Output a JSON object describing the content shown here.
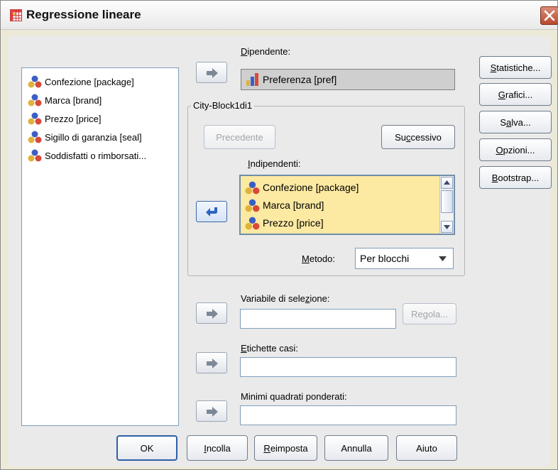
{
  "window": {
    "title": "Regressione lineare",
    "title_icon": "table-grid-icon",
    "close_icon": "close-icon"
  },
  "variables": [
    "Confezione [package]",
    "Marca [brand]",
    "Prezzo [price]",
    "Sigillo di garanzia [seal]",
    "Soddisfatti o rimborsati..."
  ],
  "dependent": {
    "label_underlined": "D",
    "label_rest": "ipendente:",
    "value": "Preferenza [pref]"
  },
  "block": {
    "title": "City-Block1di1",
    "prev_label": "Precedente",
    "next_label_pre": "Su",
    "next_label_u": "c",
    "next_label_post": "cessivo"
  },
  "independents": {
    "label_underlined": "I",
    "label_rest": "ndipendenti:",
    "items": [
      "Confezione [package]",
      "Marca [brand]",
      "Prezzo [price]"
    ]
  },
  "method": {
    "label_underlined": "M",
    "label_rest": "etodo:",
    "value": "Per blocchi"
  },
  "selection": {
    "label_pre": "Variabile di sele",
    "label_u": "z",
    "label_post": "ione:",
    "value": "",
    "rule_label_pre": "Re",
    "rule_label_u": "g",
    "rule_label_post": "ola..."
  },
  "case_labels": {
    "label_underlined": "E",
    "label_rest": "tichette casi:",
    "value": ""
  },
  "wls": {
    "label": "Minimi quadrati ponderati:",
    "value": ""
  },
  "side_buttons": [
    {
      "pre": "",
      "u": "S",
      "post": "tatistiche..."
    },
    {
      "pre": "",
      "u": "G",
      "post": "rafici..."
    },
    {
      "pre": "S",
      "u": "a",
      "post": "lva..."
    },
    {
      "pre": "",
      "u": "O",
      "post": "pzioni..."
    },
    {
      "pre": "",
      "u": "B",
      "post": "ootstrap..."
    }
  ],
  "bottom_buttons": [
    {
      "pre": "",
      "u": "",
      "post": "OK"
    },
    {
      "pre": "",
      "u": "I",
      "post": "ncolla"
    },
    {
      "pre": "",
      "u": "R",
      "post": "eimposta"
    },
    {
      "pre": "",
      "u": "",
      "post": "Annulla"
    },
    {
      "pre": "",
      "u": "",
      "post": "Aiuto"
    }
  ],
  "colors": {
    "independents_bg": "#fce9a2",
    "dialog_bg": "#eaeaea",
    "close_button": "#c0503a"
  }
}
